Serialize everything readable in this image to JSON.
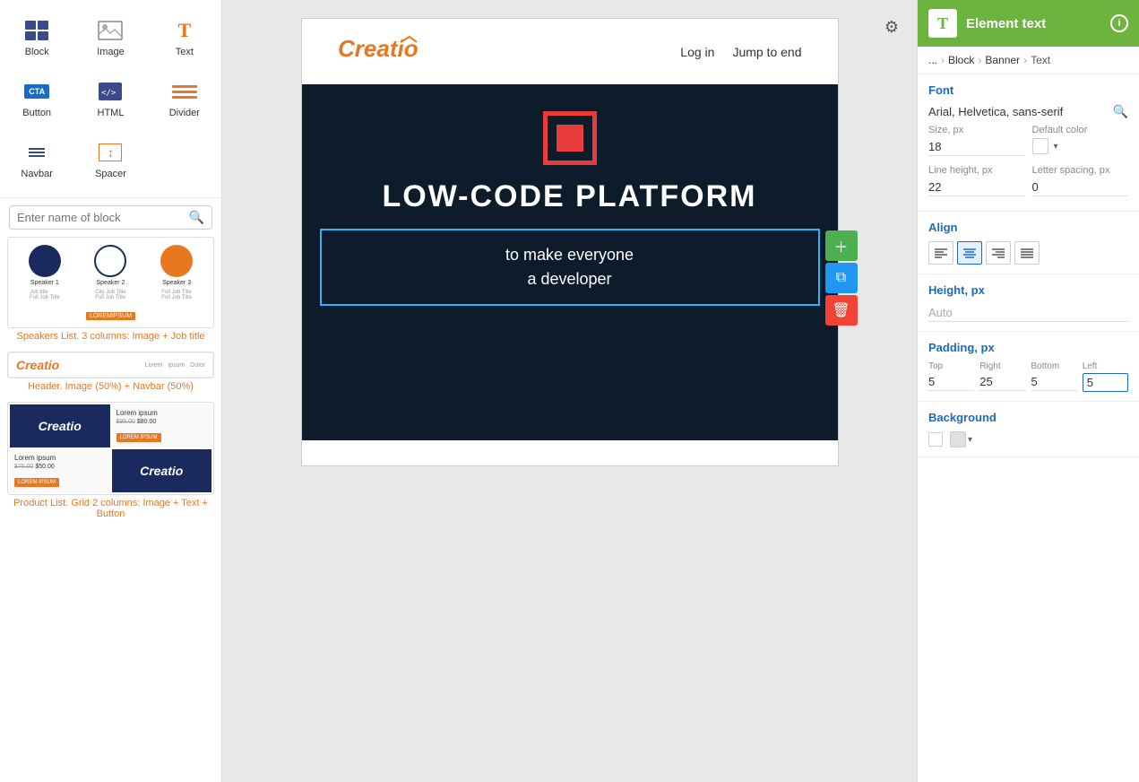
{
  "leftSidebar": {
    "blocks": [
      {
        "label": "Block",
        "icon": "block-icon"
      },
      {
        "label": "Image",
        "icon": "image-icon"
      },
      {
        "label": "Text",
        "icon": "text-icon"
      },
      {
        "label": "Button",
        "icon": "button-icon"
      },
      {
        "label": "HTML",
        "icon": "html-icon"
      },
      {
        "label": "Divider",
        "icon": "divider-icon"
      },
      {
        "label": "Navbar",
        "icon": "navbar-icon"
      },
      {
        "label": "Spacer",
        "icon": "spacer-icon"
      }
    ],
    "searchPlaceholder": "Enter name of block",
    "templates": [
      {
        "label": "Speakers List. 3 columns: Image + Job title",
        "type": "speakers"
      },
      {
        "label": "Header. Image (50%) + Navbar (50%)",
        "type": "header"
      },
      {
        "label": "Product List. Grid 2 columns: Image + Text + Button",
        "type": "product"
      }
    ]
  },
  "canvas": {
    "header": {
      "logoText": "Creatio",
      "navItems": [
        "Log in",
        "Jump to end"
      ]
    },
    "banner": {
      "title": "LOW-CODE PLATFORM",
      "subtitle1": "to make everyone",
      "subtitle2": "a developer"
    },
    "selectedText": "to make everyone\na developer"
  },
  "rightSidebar": {
    "headerIcon": "T",
    "headerTitle": "Element text",
    "breadcrumb": {
      "dots": "...",
      "block": "Block",
      "banner": "Banner",
      "text": "Text"
    },
    "font": {
      "sectionTitle": "Font",
      "fontFamily": "Arial, Helvetica, sans-serif",
      "sizeLabel": "Size, px",
      "sizeValue": "18",
      "defaultColorLabel": "Default color",
      "lineHeightLabel": "Line height, px",
      "lineHeightValue": "22",
      "letterSpacingLabel": "Letter spacing, px",
      "letterSpacingValue": "0"
    },
    "align": {
      "sectionTitle": "Align",
      "options": [
        "left",
        "center",
        "right",
        "justify"
      ]
    },
    "height": {
      "sectionTitle": "Height, px",
      "value": "Auto"
    },
    "padding": {
      "sectionTitle": "Padding, px",
      "topLabel": "Top",
      "topValue": "5",
      "rightLabel": "Right",
      "rightValue": "25",
      "bottomLabel": "Bottom",
      "bottomValue": "5",
      "leftLabel": "Left",
      "leftValue": "5"
    },
    "background": {
      "sectionTitle": "Background"
    }
  }
}
